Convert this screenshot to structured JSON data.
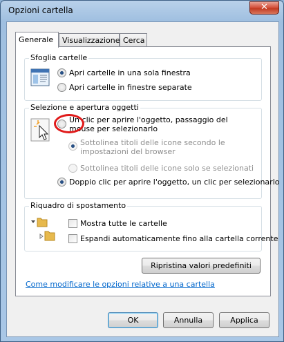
{
  "window": {
    "title": "Opzioni cartella",
    "close_glyph": "✕"
  },
  "tabs": [
    {
      "label": "Generale",
      "active": true
    },
    {
      "label": "Visualizzazione",
      "active": false
    },
    {
      "label": "Cerca",
      "active": false
    }
  ],
  "browse_group": {
    "legend": "Sfoglia cartelle",
    "options": [
      {
        "label": "Apri cartelle in una sola finestra",
        "checked": true
      },
      {
        "label": "Apri cartelle in finestre separate",
        "checked": false
      }
    ]
  },
  "click_group": {
    "legend": "Selezione e apertura oggetti",
    "single_click": {
      "label": "Un clic per aprire l'oggetto, passaggio del mouse per selezionarlo",
      "checked": false
    },
    "sub_options": [
      {
        "label": "Sottolinea titoli delle icone secondo le impostazioni del browser",
        "checked": true,
        "disabled": true
      },
      {
        "label": "Sottolinea titoli delle icone solo se selezionati",
        "checked": false,
        "disabled": true
      }
    ],
    "double_click": {
      "label": "Doppio clic per aprire l'oggetto, un clic per selezionarlo",
      "checked": true
    }
  },
  "nav_group": {
    "legend": "Riquadro di spostamento",
    "options": [
      {
        "label": "Mostra tutte le cartelle",
        "checked": false
      },
      {
        "label": "Espandi automaticamente fino alla cartella corrente",
        "checked": false
      }
    ]
  },
  "restore_button": "Ripristina valori predefiniti",
  "help_link": "Come modificare le opzioni relative a una cartella",
  "buttons": {
    "ok": "OK",
    "cancel": "Annulla",
    "apply": "Applica"
  },
  "colors": {
    "link": "#0066cc",
    "highlight_ring": "#e01a1a",
    "close_button": "#c23b22"
  }
}
